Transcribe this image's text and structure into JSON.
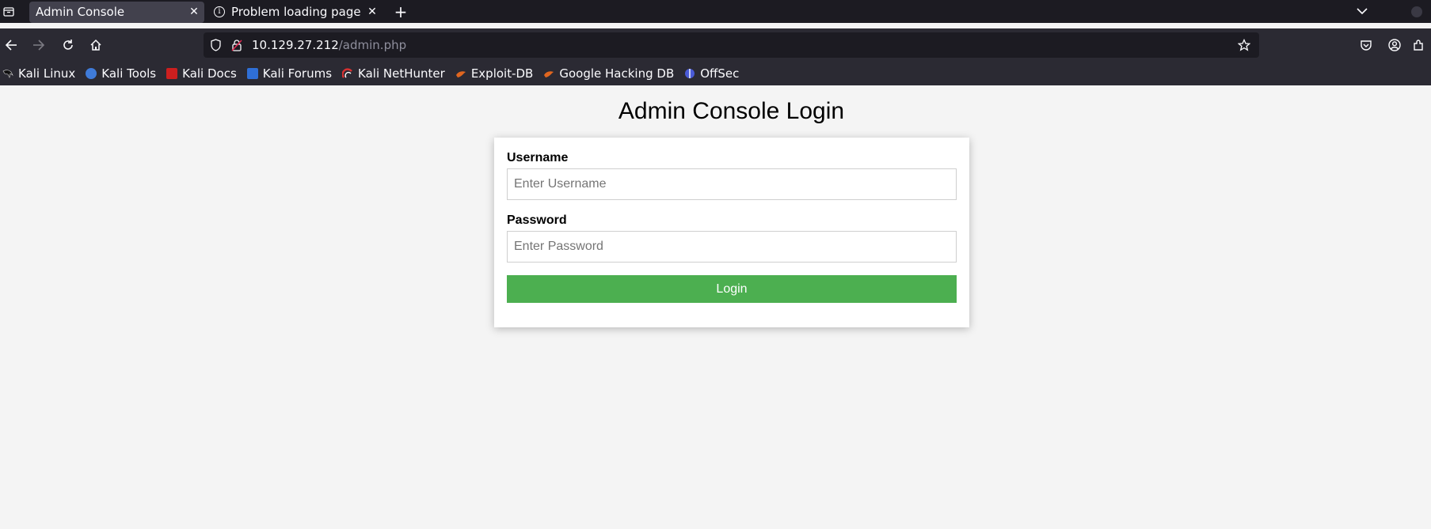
{
  "browser": {
    "tabs": [
      {
        "label": "Admin Console",
        "active": true
      },
      {
        "label": "Problem loading page",
        "active": false
      }
    ],
    "address": {
      "host": "10.129.27.212",
      "path": "/admin.php"
    },
    "bookmarks": [
      {
        "label": "Kali Linux",
        "icon": "kali-dragon-icon",
        "color": "#111111"
      },
      {
        "label": "Kali Tools",
        "icon": "kali-tools-icon",
        "color": "#3f7bd9"
      },
      {
        "label": "Kali Docs",
        "icon": "kali-docs-icon",
        "color": "#cc1f1f"
      },
      {
        "label": "Kali Forums",
        "icon": "kali-forums-icon",
        "color": "#2f6fd6"
      },
      {
        "label": "Kali NetHunter",
        "icon": "kali-nethunter-icon",
        "color": "#d93030"
      },
      {
        "label": "Exploit-DB",
        "icon": "exploit-db-icon",
        "color": "#e0661f"
      },
      {
        "label": "Google Hacking DB",
        "icon": "ghdb-icon",
        "color": "#e0661f"
      },
      {
        "label": "OffSec",
        "icon": "offsec-icon",
        "color": "#4a5bd6"
      }
    ]
  },
  "page": {
    "title": "Admin Console Login",
    "username": {
      "label": "Username",
      "placeholder": "Enter Username",
      "value": ""
    },
    "password": {
      "label": "Password",
      "placeholder": "Enter Password",
      "value": ""
    },
    "login_label": "Login"
  },
  "colors": {
    "login_button": "#4caf50",
    "page_background": "#f4f4f4",
    "toolbar": "#2b2a33",
    "tabbar": "#1c1b22"
  }
}
